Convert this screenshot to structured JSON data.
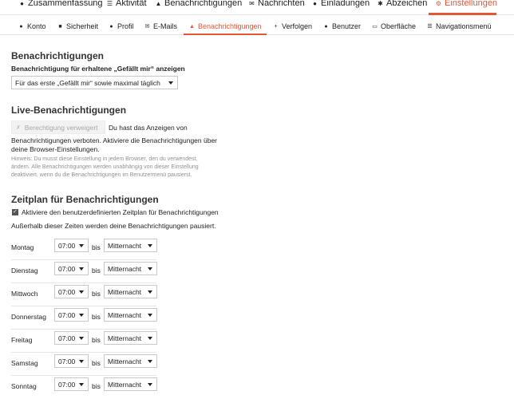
{
  "top_nav": {
    "items": [
      {
        "icon": "user-icon",
        "label": "Zusammenfassung"
      },
      {
        "icon": "list-icon",
        "label": "Aktivität"
      },
      {
        "icon": "bell-icon",
        "label": "Benachrichtigungen"
      },
      {
        "icon": "envelope-icon",
        "label": "Nachrichten"
      },
      {
        "icon": "user-plus-icon",
        "label": "Einladungen"
      },
      {
        "icon": "certificate-icon",
        "label": "Abzeichen"
      },
      {
        "icon": "gear-icon",
        "label": "Einstellungen"
      }
    ],
    "active": "Einstellungen"
  },
  "sub_nav": {
    "items": [
      {
        "icon": "user-icon",
        "label": "Konto"
      },
      {
        "icon": "lock-icon",
        "label": "Sicherheit"
      },
      {
        "icon": "user-icon",
        "label": "Profil"
      },
      {
        "icon": "envelope-icon",
        "label": "E-Mails"
      },
      {
        "icon": "bell-icon",
        "label": "Benachrichtigungen"
      },
      {
        "icon": "plus-icon",
        "label": "Verfolgen"
      },
      {
        "icon": "users-icon",
        "label": "Benutzer"
      },
      {
        "icon": "desktop-icon",
        "label": "Oberfläche"
      },
      {
        "icon": "bars-icon",
        "label": "Navigationsmenü"
      }
    ],
    "active": "Benachrichtigungen"
  },
  "notifications": {
    "title": "Benachrichtigungen",
    "likes_label": "Benachrichtigung für erhaltene „Gefällt mir“ anzeigen",
    "likes_value": "Für das erste „Gefällt mir“ sowie maximal täglich"
  },
  "live": {
    "title": "Live-Benachrichtigungen",
    "button": "Berechtigung verweigert",
    "text_line1": "Du hast das Anzeigen von",
    "text_line2": "Benachrichtigungen verboten. Aktiviere die Benachrichtigungen über",
    "text_line3": "deine Browser-Einstellungen.",
    "hint_line1": "Hinweis: Du musst diese Einstellung in jedem Browser, den du verwendest,",
    "hint_line2": "ändern. Alle Benachrichtigungen werden unabhängig von dieser Einstellung",
    "hint_line3": "deaktiviert, wenn du die Benachrichtigungen im Benutzermenü pausierst."
  },
  "schedule": {
    "title": "Zeitplan für Benachrichtigungen",
    "checkbox_label": "Aktiviere den benutzerdefinierten Zeitplan für Benachrichtigungen",
    "checked": true,
    "note": "Außerhalb dieser Zeiten werden deine Benachrichtigungen pausiert.",
    "bis": "bis",
    "days": [
      {
        "day": "Montag",
        "from": "07:00",
        "to": "Mitternacht"
      },
      {
        "day": "Dienstag",
        "from": "07:00",
        "to": "Mitternacht"
      },
      {
        "day": "Mittwoch",
        "from": "07:00",
        "to": "Mitternacht"
      },
      {
        "day": "Donnerstag",
        "from": "07:00",
        "to": "Mitternacht"
      },
      {
        "day": "Freitag",
        "from": "07:00",
        "to": "Mitternacht"
      },
      {
        "day": "Samstag",
        "from": "07:00",
        "to": "Mitternacht"
      },
      {
        "day": "Sonntag",
        "from": "07:00",
        "to": "Mitternacht"
      }
    ]
  },
  "colors": {
    "accent": "#e45735"
  }
}
